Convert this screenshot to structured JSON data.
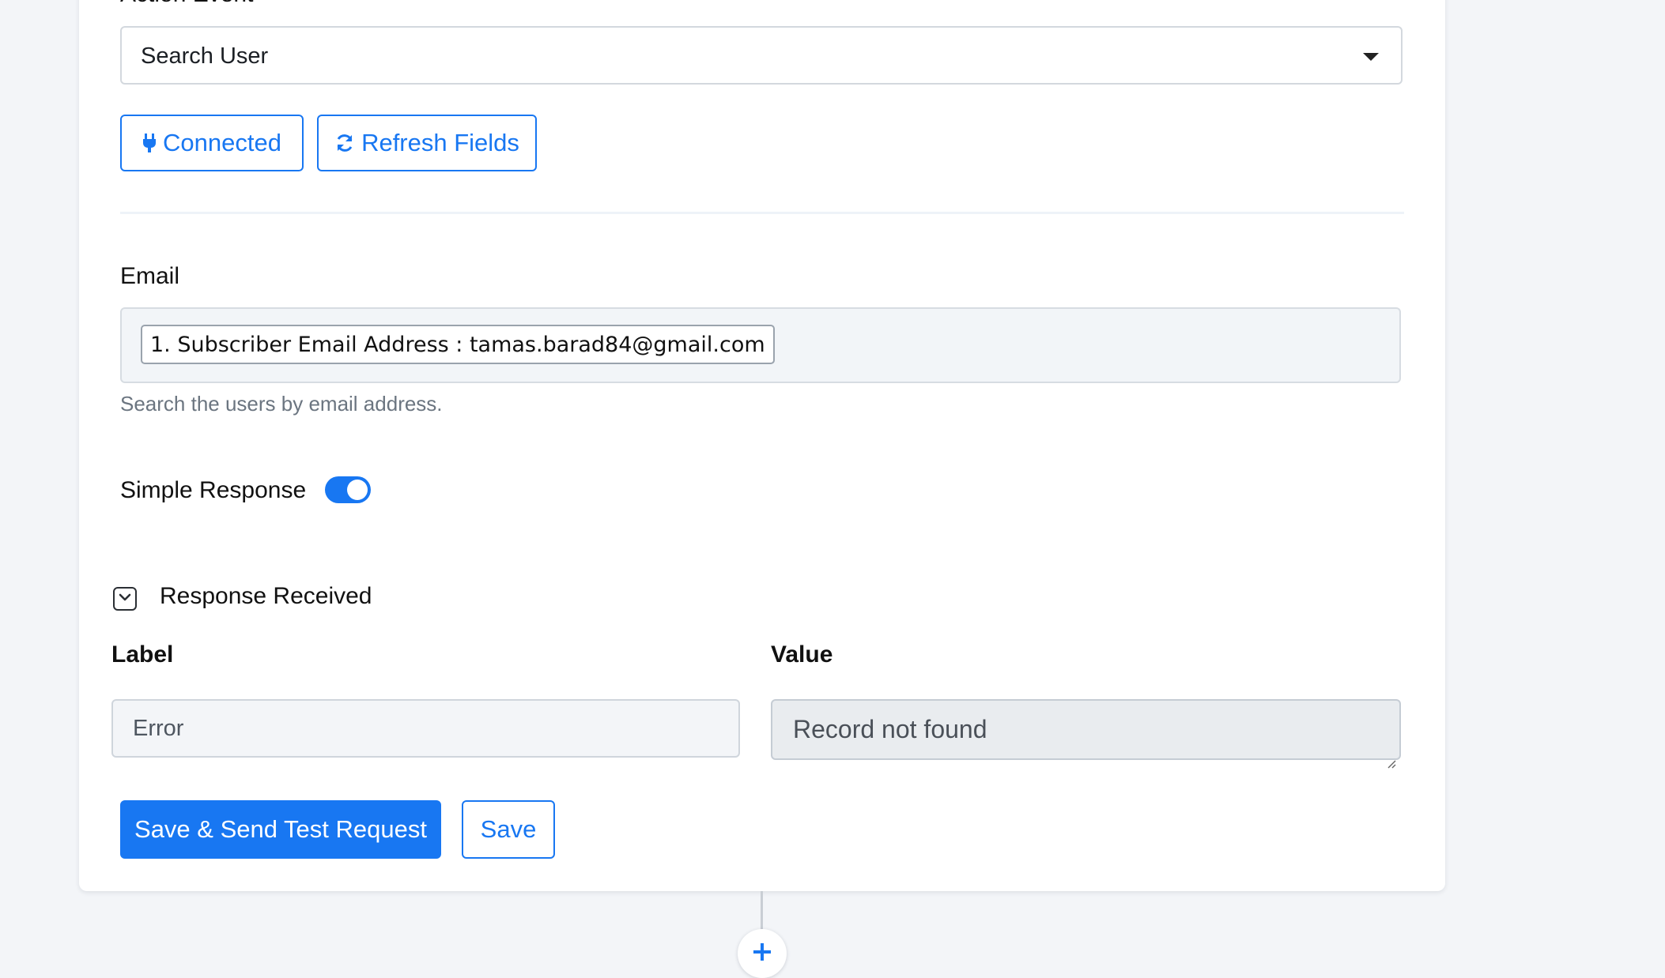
{
  "action_event": {
    "label": "Action Event",
    "selected": "Search User"
  },
  "buttons": {
    "connected": "Connected",
    "refresh_fields": "Refresh Fields",
    "save_send": "Save & Send Test Request",
    "save": "Save"
  },
  "email": {
    "label": "Email",
    "token": "1. Subscriber Email Address : tamas.barad84@gmail.com",
    "help": "Search the users by email address."
  },
  "simple_response": {
    "label": "Simple Response",
    "enabled": true
  },
  "response": {
    "title": "Response Received",
    "label_header": "Label",
    "value_header": "Value",
    "label_value": "Error",
    "value_value": "Record not found"
  },
  "colors": {
    "accent": "#1877f2",
    "background": "#f3f5f8"
  },
  "icons": {
    "connected": "plug-icon",
    "refresh": "refresh-icon",
    "select": "caret-down-icon",
    "collapse": "chevron-down-icon",
    "add": "plus-icon"
  }
}
